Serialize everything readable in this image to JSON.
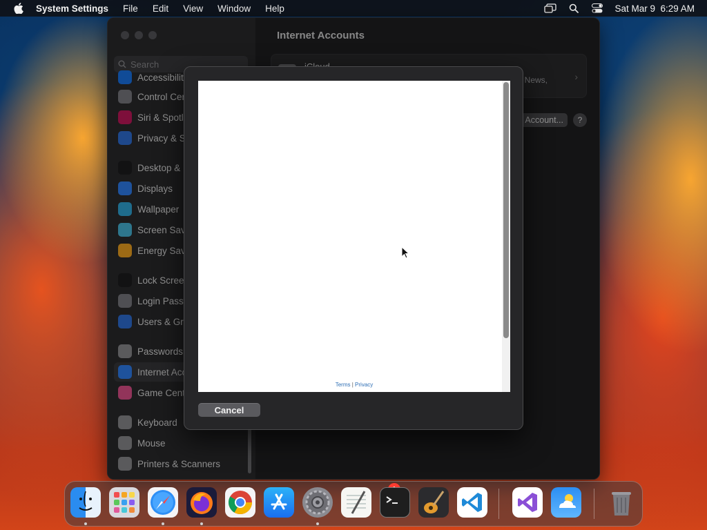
{
  "menubar": {
    "app_name": "System Settings",
    "menus": [
      "File",
      "Edit",
      "View",
      "Window",
      "Help"
    ],
    "clock": "Sat Mar 9  6:29 AM"
  },
  "settings": {
    "search_placeholder": "Search",
    "pane_title": "Internet Accounts",
    "sidebar_items": [
      {
        "label": "Accessibility",
        "icon": "accessibility-icon",
        "color": "#1a73e8"
      },
      {
        "label": "Control Centre",
        "icon": "control-centre-icon",
        "color": "#7a7a80"
      },
      {
        "label": "Siri & Spotlight",
        "icon": "siri-icon",
        "color": "#c2185b"
      },
      {
        "label": "Privacy & Security",
        "icon": "hand-icon",
        "color": "#2f6fd6"
      },
      {
        "label": "Desktop & Dock",
        "icon": "dock-icon",
        "color": "#1c1c1e"
      },
      {
        "label": "Displays",
        "icon": "sun-icon",
        "color": "#2f7ff0"
      },
      {
        "label": "Wallpaper",
        "icon": "wallpaper-icon",
        "color": "#30a7d8"
      },
      {
        "label": "Screen Saver",
        "icon": "screensaver-icon",
        "color": "#48b6d8"
      },
      {
        "label": "Energy Saver",
        "icon": "battery-icon",
        "color": "#f0a321"
      },
      {
        "label": "Lock Screen",
        "icon": "lock-icon",
        "color": "#1c1c1e"
      },
      {
        "label": "Login Password",
        "icon": "login-lock-icon",
        "color": "#7a7a80"
      },
      {
        "label": "Users & Groups",
        "icon": "users-icon",
        "color": "#2f6fd6"
      },
      {
        "label": "Passwords",
        "icon": "key-icon",
        "color": "#8a8a8e"
      },
      {
        "label": "Internet Accounts",
        "icon": "at-icon",
        "color": "#2f7ff0"
      },
      {
        "label": "Game Center",
        "icon": "game-center-icon",
        "color": "#e0508a"
      },
      {
        "label": "Keyboard",
        "icon": "keyboard-icon",
        "color": "#8a8a8e"
      },
      {
        "label": "Mouse",
        "icon": "mouse-icon",
        "color": "#8a8a8e"
      },
      {
        "label": "Printers & Scanners",
        "icon": "printer-icon",
        "color": "#8a8a8e"
      }
    ],
    "icloud_label": "iCloud",
    "icloud_sub": "News,",
    "add_account_label": "Account...",
    "help_label": "?"
  },
  "sheet": {
    "terms": "Terms",
    "separator": "|",
    "privacy": "Privacy",
    "cancel_label": "Cancel"
  },
  "dock": {
    "apps": [
      "Finder",
      "Launchpad",
      "Safari",
      "Firefox",
      "Chrome",
      "App Store",
      "System Settings",
      "TextEdit",
      "Terminal",
      "GarageBand",
      "Visual Studio Code",
      "Visual Studio",
      "Weather",
      "Trash"
    ],
    "settings_badge": "1"
  }
}
